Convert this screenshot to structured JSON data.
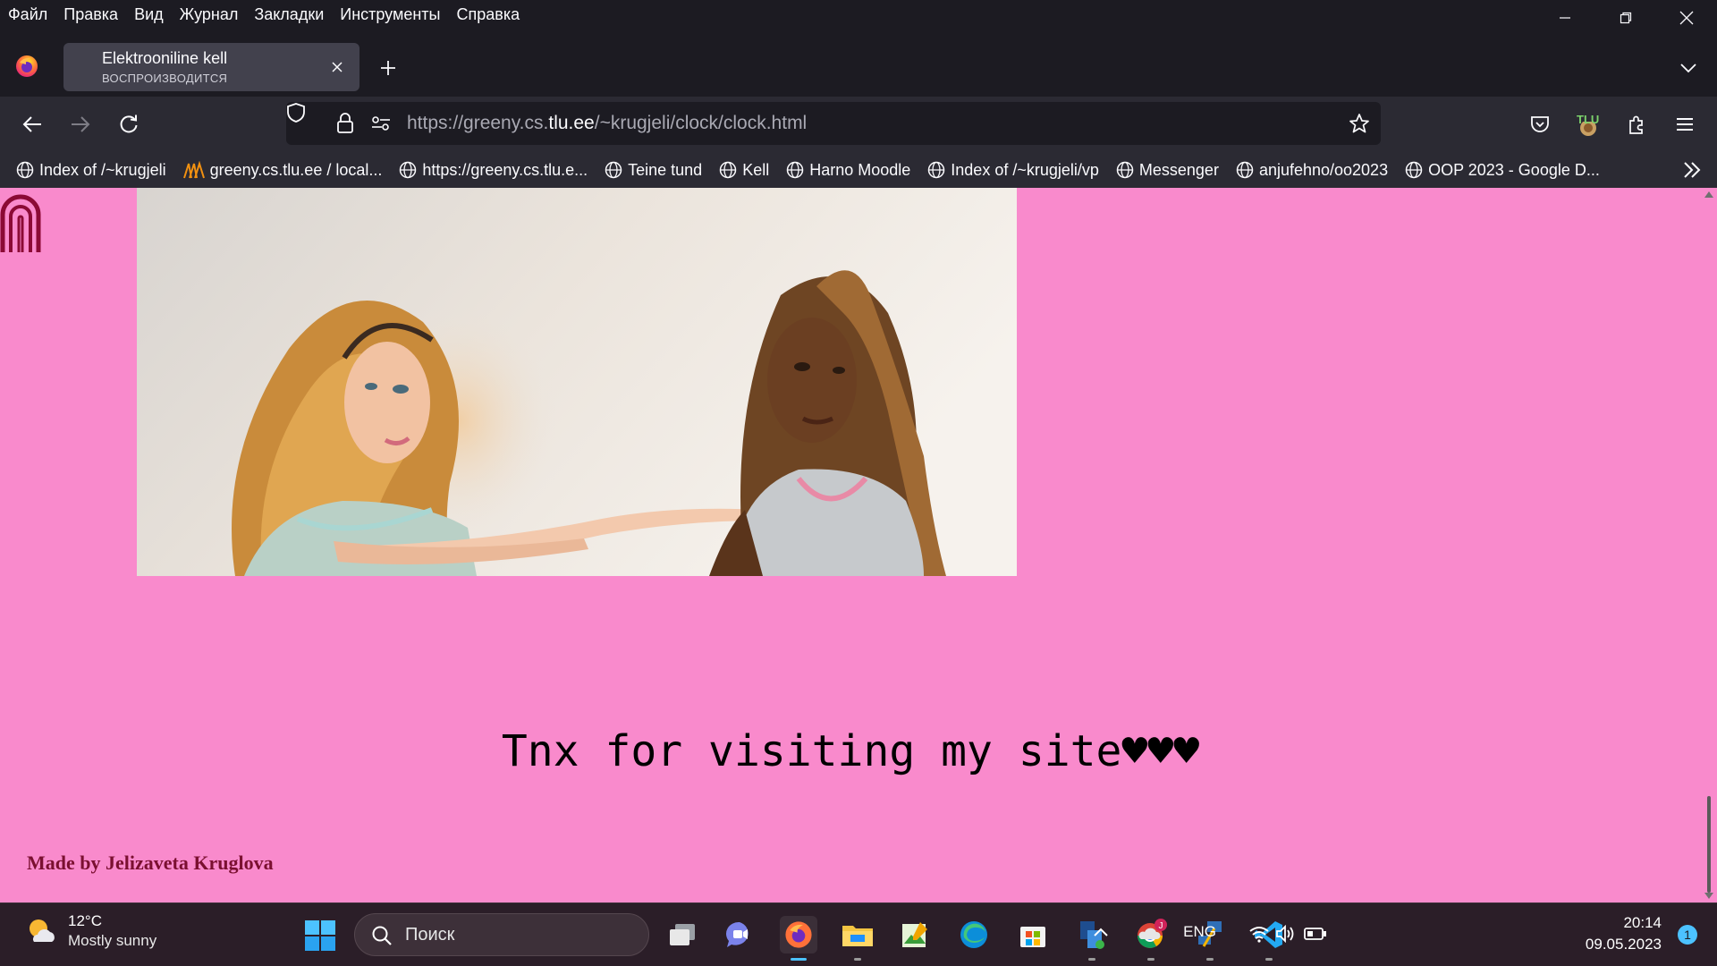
{
  "menubar": {
    "items": [
      "Файл",
      "Правка",
      "Вид",
      "Журнал",
      "Закладки",
      "Инструменты",
      "Справка"
    ]
  },
  "tab": {
    "title": "Elektrooniline kell",
    "subtitle": "ВОСПРОИЗВОДИТСЯ"
  },
  "navbar": {
    "url_prefix": "https://greeny.cs.",
    "url_domain": "tlu.ee",
    "url_path": "/~krugjeli/clock/clock.html",
    "profile_badge": "TLU"
  },
  "bookmarks": [
    {
      "label": "Index of /~krugjeli",
      "icon": "globe-icon"
    },
    {
      "label": "greeny.cs.tlu.ee / local...",
      "icon": "phpmyadmin-icon"
    },
    {
      "label": "https://greeny.cs.tlu.e...",
      "icon": "globe-icon"
    },
    {
      "label": "Teine tund",
      "icon": "globe-icon"
    },
    {
      "label": "Kell",
      "icon": "globe-icon"
    },
    {
      "label": "Harno Moodle",
      "icon": "globe-icon"
    },
    {
      "label": "Index of /~krugjeli/vp",
      "icon": "globe-icon"
    },
    {
      "label": "Messenger",
      "icon": "globe-icon"
    },
    {
      "label": "anjufehno/oo2023",
      "icon": "globe-icon"
    },
    {
      "label": "OOP 2023 - Google D...",
      "icon": "globe-icon"
    }
  ],
  "page": {
    "background": "#f98acc",
    "thanks_text": "Tnx for visiting my site",
    "hearts": "♥♥♥",
    "credit": "Made by Jelizaveta Kruglova"
  },
  "taskbar": {
    "weather_temp": "12°C",
    "weather_cond": "Mostly sunny",
    "search_placeholder": "Поиск",
    "lang": "ENG",
    "time": "20:14",
    "date": "09.05.2023",
    "notifications": "1"
  }
}
